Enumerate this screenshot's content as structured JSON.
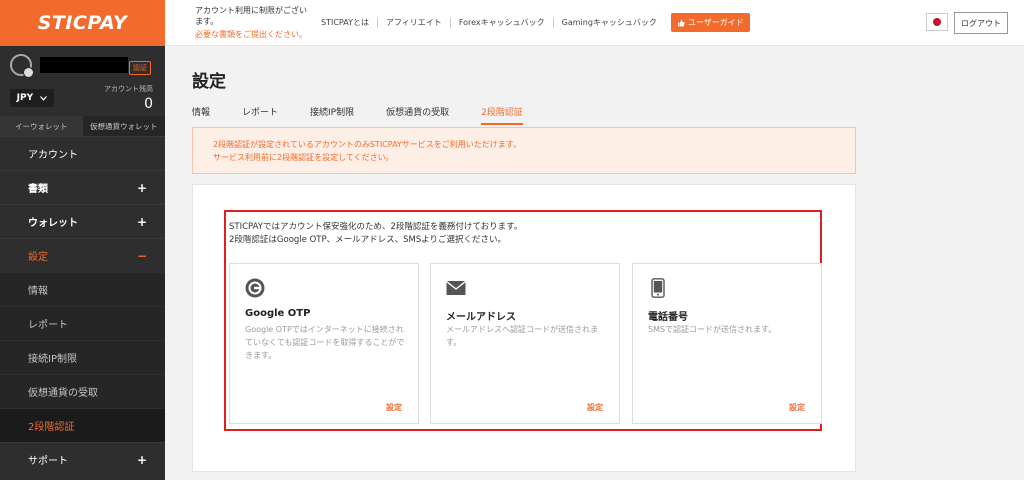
{
  "logo": "STICPAY",
  "user": {
    "auth_badge": "認証"
  },
  "balance": {
    "currency": "JPY",
    "label": "アカウント残高",
    "value": "0"
  },
  "wallet_tabs": [
    "イーウォレット",
    "仮想通貨ウォレット"
  ],
  "nav": {
    "account": "アカウント",
    "documents": "書類",
    "wallet": "ウォレット",
    "settings": "設定",
    "settings_sub": [
      "情報",
      "レポート",
      "接続IP制限",
      "仮想通貨の受取",
      "2段階認証"
    ],
    "support": "サポート",
    "plus": "+",
    "minus": "−"
  },
  "topbar": {
    "notice_line1": "アカウント利用に制限がございます。",
    "notice_line2": "必要な書類をご提出ください。",
    "links": [
      "STICPAYとは",
      "アフィリエイト",
      "Forexキャッシュバック",
      "Gamingキャッシュバック"
    ],
    "guide_button": "ユーザーガイド",
    "logout": "ログアウト"
  },
  "page": {
    "title": "設定",
    "tabs": [
      "情報",
      "レポート",
      "接続IP制限",
      "仮想通貨の受取",
      "2段階認証"
    ],
    "active_tab": "2段階認証",
    "alert_line1": "2段階認証が設定されているアカウントのみSTICPAYサービスをご利用いただけます。",
    "alert_line2": "サービス利用前に2段階認証を設定してください。",
    "intro_line1": "STICPAYではアカウント保安強化のため、2段階認証を義務付けております。",
    "intro_line2": "2段階認証はGoogle OTP、メールアドレス、SMSよりご選択ください。"
  },
  "cards": [
    {
      "icon": "google-otp-icon",
      "title": "Google OTP",
      "desc": "Google OTPではインターネットに接続されていなくても認証コードを取得することができます。",
      "link": "設定"
    },
    {
      "icon": "mail-icon",
      "title": "メールアドレス",
      "desc": "メールアドレスへ認証コードが送信されます。",
      "link": "設定"
    },
    {
      "icon": "phone-icon",
      "title": "電話番号",
      "desc": "SMSで認証コードが送信されます。",
      "link": "設定"
    }
  ],
  "colors": {
    "brand": "#f26b2c",
    "sidebar": "#2e2e2e",
    "highlight": "#e02020"
  }
}
